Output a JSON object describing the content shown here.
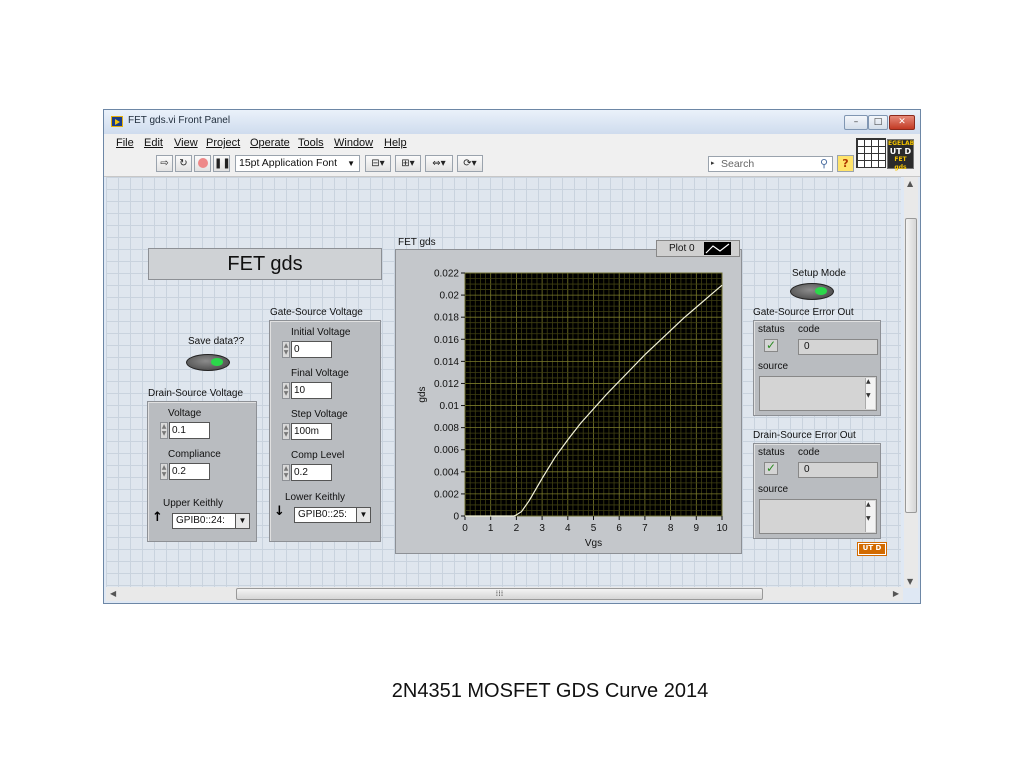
{
  "window": {
    "title": "FET gds.vi Front Panel",
    "controls": {
      "minimize": "–",
      "maximize": "□",
      "close": "✕"
    }
  },
  "menu": [
    "File",
    "Edit",
    "View",
    "Project",
    "Operate",
    "Tools",
    "Window",
    "Help"
  ],
  "toolbar": {
    "font": "15pt Application Font",
    "search_placeholder": "Search",
    "help": "?",
    "vi_icon_lines": [
      "EGELAB",
      "UT D",
      "FET gds"
    ]
  },
  "panel": {
    "title": "FET gds",
    "save_data_label": "Save data??",
    "drain_source": {
      "label": "Drain-Source Voltage",
      "voltage_label": "Voltage",
      "voltage_value": "0.1",
      "compliance_label": "Compliance",
      "compliance_value": "0.2",
      "keithly_label": "Upper Keithly",
      "keithly_value": "GPIB0::24:"
    },
    "gate_source": {
      "label": "Gate-Source Voltage",
      "initial_label": "Initial Voltage",
      "initial_value": "0",
      "final_label": "Final Voltage",
      "final_value": "10",
      "step_label": "Step Voltage",
      "step_value": "100m",
      "comp_label": "Comp Level",
      "comp_value": "0.2",
      "keithly_label": "Lower Keithly",
      "keithly_value": "GPIB0::25:"
    },
    "graph": {
      "label": "FET gds",
      "legend": "Plot 0"
    },
    "setup_mode_label": "Setup Mode",
    "gs_error": {
      "label": "Gate-Source Error Out",
      "status_label": "status",
      "code_label": "code",
      "code_value": "0",
      "source_label": "source"
    },
    "ds_error": {
      "label": "Drain-Source Error Out",
      "status_label": "status",
      "code_label": "code",
      "code_value": "0",
      "source_label": "source"
    },
    "utd_badge": "UT D"
  },
  "caption": "2N4351 MOSFET GDS Curve 2014",
  "chart_data": {
    "type": "line",
    "title": "",
    "xlabel": "Vgs",
    "ylabel": "gds",
    "xlim": [
      0,
      10
    ],
    "ylim": [
      0,
      0.022
    ],
    "xticks": [
      0,
      1,
      2,
      3,
      4,
      5,
      6,
      7,
      8,
      9,
      10
    ],
    "yticks": [
      "0",
      "0.002",
      "0.004",
      "0.006",
      "0.008",
      "0.01",
      "0.012",
      "0.014",
      "0.016",
      "0.018",
      "0.02",
      "0.022"
    ],
    "grid": true,
    "series": [
      {
        "name": "Plot 0",
        "color": "#f2f2d8",
        "x": [
          0,
          1.9,
          2.0,
          2.2,
          2.5,
          3.0,
          3.5,
          4.0,
          4.5,
          5.0,
          5.5,
          6.0,
          6.5,
          7.0,
          7.5,
          8.0,
          8.5,
          9.0,
          9.5,
          10.0
        ],
        "y": [
          0,
          0,
          0.0001,
          0.0004,
          0.0014,
          0.0034,
          0.0053,
          0.0069,
          0.0084,
          0.0097,
          0.011,
          0.0122,
          0.0134,
          0.0146,
          0.0157,
          0.0168,
          0.0179,
          0.0189,
          0.0199,
          0.0209
        ]
      }
    ]
  }
}
